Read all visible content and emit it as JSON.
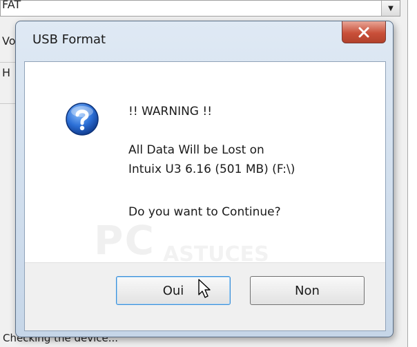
{
  "background": {
    "combo_value": "FAT",
    "fragment_v": "Vo",
    "fragment_h": "H",
    "status_text": "Checking the device..."
  },
  "dialog": {
    "title": "USB Format",
    "warning_header": "!! WARNING !!",
    "message_line1": "All Data Will be Lost on",
    "message_line2": "Intuix U3 6.16 (501 MB) (F:\\)",
    "question": "Do you want to Continue?",
    "buttons": {
      "yes_label": "Oui",
      "no_label": "Non"
    },
    "icon": "help-question-icon"
  },
  "watermark": {
    "main": "PC",
    "sub": "ASTUCES"
  },
  "colors": {
    "dialog_frame": "#c6d6e8",
    "close_button": "#c9503a",
    "help_icon_blue": "#1f5fbf"
  }
}
